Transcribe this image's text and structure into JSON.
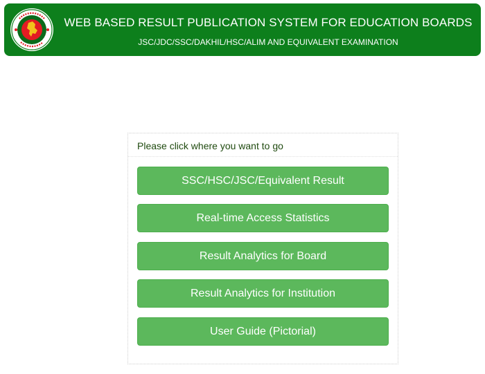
{
  "header": {
    "title": "WEB BASED RESULT PUBLICATION SYSTEM FOR EDUCATION BOARDS",
    "subtitle": "JSC/JDC/SSC/DAKHIL/HSC/ALIM AND EQUIVALENT EXAMINATION",
    "logo_icon": "government-seal-icon",
    "background_color": "#0d7f1c"
  },
  "panel": {
    "heading": "Please click where you want to go",
    "buttons": [
      {
        "label": "SSC/HSC/JSC/Equivalent Result"
      },
      {
        "label": "Real-time Access Statistics"
      },
      {
        "label": "Result Analytics for Board"
      },
      {
        "label": "Result Analytics for Institution"
      },
      {
        "label": "User Guide (Pictorial)"
      }
    ],
    "button_color": "#5cb85c"
  }
}
